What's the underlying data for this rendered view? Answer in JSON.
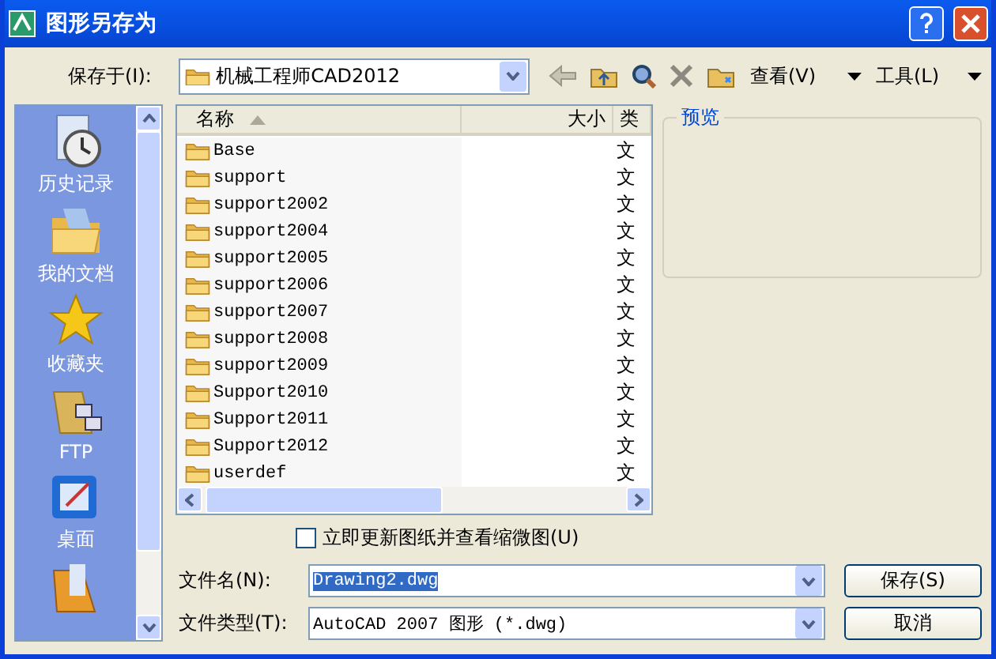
{
  "window": {
    "title": "图形另存为"
  },
  "save_in": {
    "label": "保存于(I):",
    "value": "机械工程师CAD2012"
  },
  "toolbar": {
    "view_menu": "查看(V)",
    "tools_menu": "工具(L)"
  },
  "sidebar": {
    "items": [
      {
        "label": "历史记录",
        "kind": "history"
      },
      {
        "label": "我的文档",
        "kind": "documents"
      },
      {
        "label": "收藏夹",
        "kind": "favorites"
      },
      {
        "label": "FTP",
        "kind": "ftp"
      },
      {
        "label": "桌面",
        "kind": "desktop"
      },
      {
        "kind": "buzzsaw"
      }
    ]
  },
  "file_list": {
    "columns": [
      "名称",
      "大小",
      "类"
    ],
    "rows": [
      {
        "name": "Base",
        "type": "文"
      },
      {
        "name": "support",
        "type": "文"
      },
      {
        "name": "support2002",
        "type": "文"
      },
      {
        "name": "support2004",
        "type": "文"
      },
      {
        "name": "support2005",
        "type": "文"
      },
      {
        "name": "support2006",
        "type": "文"
      },
      {
        "name": "support2007",
        "type": "文"
      },
      {
        "name": "support2008",
        "type": "文"
      },
      {
        "name": "support2009",
        "type": "文"
      },
      {
        "name": "Support2010",
        "type": "文"
      },
      {
        "name": "Support2011",
        "type": "文"
      },
      {
        "name": "Support2012",
        "type": "文"
      },
      {
        "name": "userdef",
        "type": "文"
      }
    ]
  },
  "preview": {
    "title": "预览"
  },
  "update_thumbnail": {
    "label": "立即更新图纸并查看缩微图(U)",
    "checked": false
  },
  "file_name": {
    "label": "文件名(N):",
    "value": "Drawing2.dwg"
  },
  "file_type": {
    "label": "文件类型(T):",
    "value": "AutoCAD 2007 图形 (*.dwg)"
  },
  "buttons": [
    "保存(S)",
    "取消"
  ]
}
